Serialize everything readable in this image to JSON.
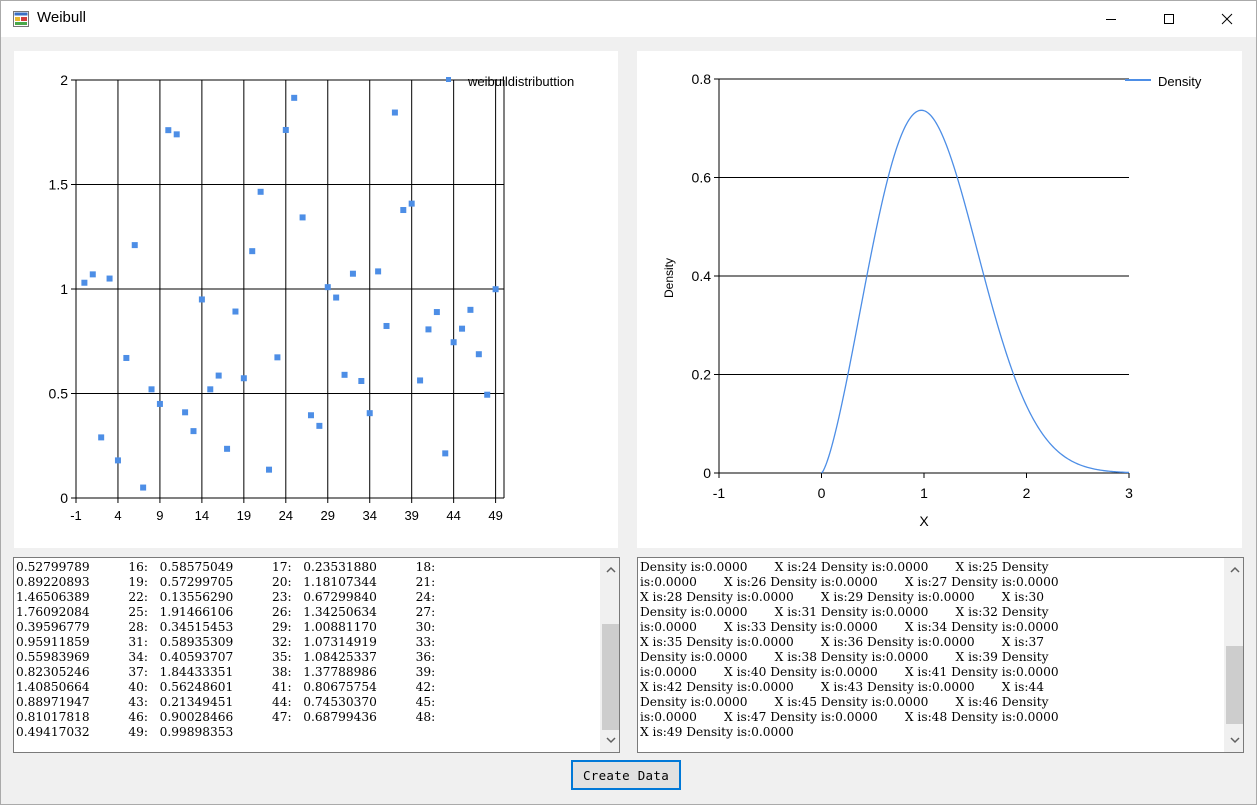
{
  "window": {
    "title": "Weibull"
  },
  "scatter_chart": {
    "legend": "weibulldistributtion",
    "y_ticks": [
      "2",
      "1.5",
      "1",
      "0.5",
      "0"
    ],
    "x_ticks": [
      "-1",
      "4",
      "9",
      "14",
      "19",
      "24",
      "29",
      "34",
      "39",
      "44",
      "49"
    ],
    "point_color": "#4d8ee6"
  },
  "density_chart": {
    "legend": "Density",
    "ylabel": "Density",
    "xlabel": "X",
    "y_ticks": [
      "0.8",
      "0.6",
      "0.4",
      "0.2",
      "0"
    ],
    "x_ticks": [
      "-1",
      "0",
      "1",
      "2",
      "3"
    ],
    "line_color": "#4d8ee6"
  },
  "chart_data": [
    {
      "type": "scatter",
      "series": [
        {
          "name": "weibulldistributtion",
          "x": [
            0,
            1,
            2,
            3,
            4,
            5,
            6,
            7,
            8,
            9,
            10,
            11,
            12,
            13,
            14,
            15,
            16,
            17,
            18,
            19,
            20,
            21,
            22,
            23,
            24,
            25,
            26,
            27,
            28,
            29,
            30,
            31,
            32,
            33,
            34,
            35,
            36,
            37,
            38,
            39,
            40,
            41,
            42,
            43,
            44,
            45,
            46,
            47,
            48,
            49
          ],
          "y": [
            1.03,
            1.07,
            0.29,
            1.05,
            0.18,
            0.67,
            1.21,
            0.05,
            0.52,
            0.45,
            1.76,
            1.74,
            0.41,
            0.32,
            0.95,
            0.52,
            0.58575049,
            0.2353188,
            0.89220893,
            0.57299705,
            1.18107344,
            1.46506389,
            0.1355629,
            0.6729984,
            1.76092084,
            1.91466106,
            1.34250634,
            0.39596779,
            0.34515453,
            1.0088117,
            0.95911859,
            0.58935309,
            1.07314919,
            0.55983969,
            0.40593707,
            1.08425337,
            0.82305246,
            1.84433351,
            1.37788986,
            1.40850664,
            0.56248601,
            0.80675754,
            0.88971947,
            0.21349451,
            0.7453037,
            0.81017818,
            0.90028466,
            0.68799436,
            0.49417032,
            0.99898353
          ]
        }
      ],
      "xlim": [
        -1,
        50
      ],
      "ylim": [
        0,
        2
      ],
      "grid": true,
      "legend_position": "top-right"
    },
    {
      "type": "line",
      "series": [
        {
          "name": "Density"
        }
      ],
      "curve": "normal-like peak at x=1, max 0.735, zero outside [0, 2.4]",
      "xlim": [
        -1,
        3
      ],
      "ylim": [
        0,
        0.8
      ],
      "xlabel": "X",
      "ylabel": "Density",
      "grid": true,
      "legend_position": "top-right"
    }
  ],
  "left_textbox": {
    "lines": [
      "0.52799789          16:   0.58575049          17:   0.23531880          18:",
      "0.89220893          19:   0.57299705          20:   1.18107344          21:",
      "1.46506389          22:   0.13556290          23:   0.67299840          24:",
      "1.76092084          25:   1.91466106          26:   1.34250634          27:",
      "0.39596779          28:   0.34515453          29:   1.00881170          30:",
      "0.95911859          31:   0.58935309          32:   1.07314919          33:",
      "0.55983969          34:   0.40593707          35:   1.08425337          36:",
      "0.82305246          37:   1.84433351          38:   1.37788986          39:",
      "1.40850664          40:   0.56248601          41:   0.80675754          42:",
      "0.88971947          43:   0.21349451          44:   0.74530370          45:",
      "0.81017818          46:   0.90028466          47:   0.68799436          48:",
      "0.49417032          49:   0.99898353"
    ]
  },
  "right_textbox": {
    "lines": [
      "Density is:0.0000       X is:24 Density is:0.0000       X is:25 Density",
      "is:0.0000       X is:26 Density is:0.0000       X is:27 Density is:0.0000",
      "X is:28 Density is:0.0000       X is:29 Density is:0.0000       X is:30",
      "Density is:0.0000       X is:31 Density is:0.0000       X is:32 Density",
      "is:0.0000       X is:33 Density is:0.0000       X is:34 Density is:0.0000",
      "X is:35 Density is:0.0000       X is:36 Density is:0.0000       X is:37",
      "Density is:0.0000       X is:38 Density is:0.0000       X is:39 Density",
      "is:0.0000       X is:40 Density is:0.0000       X is:41 Density is:0.0000",
      "X is:42 Density is:0.0000       X is:43 Density is:0.0000       X is:44",
      "Density is:0.0000       X is:45 Density is:0.0000       X is:46 Density",
      "is:0.0000       X is:47 Density is:0.0000       X is:48 Density is:0.0000",
      "X is:49 Density is:0.0000"
    ]
  },
  "create_button": {
    "label": "Create Data"
  }
}
